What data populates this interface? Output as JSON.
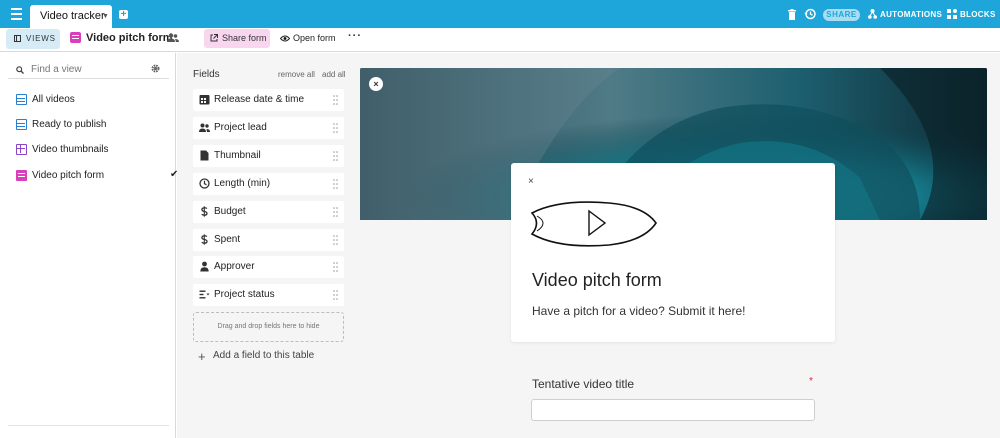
{
  "topbar": {
    "base_name": "Video tracker",
    "share_label": "SHARE",
    "automations_label": "AUTOMATIONS",
    "blocks_label": "BLOCKS",
    "bg_color": "#1ea6db"
  },
  "viewbar": {
    "views_label": "VIEWS",
    "current_view": "Video pitch form",
    "share_form_label": "Share form",
    "open_form_label": "Open form",
    "more_label": "···"
  },
  "sidebar": {
    "search_placeholder": "Find a view",
    "items": [
      {
        "label": "All videos",
        "icon": "grid-view-icon"
      },
      {
        "label": "Ready to publish",
        "icon": "grid-view-icon"
      },
      {
        "label": "Video thumbnails",
        "icon": "gallery-view-icon"
      },
      {
        "label": "Video pitch form",
        "icon": "form-view-icon",
        "selected": true
      }
    ]
  },
  "fields_panel": {
    "title": "Fields",
    "remove_all_label": "remove all",
    "add_all_label": "add all",
    "fields": [
      {
        "label": "Release date & time",
        "icon": "calendar-icon"
      },
      {
        "label": "Project lead",
        "icon": "collaborator-icon"
      },
      {
        "label": "Thumbnail",
        "icon": "attachment-icon"
      },
      {
        "label": "Length (min)",
        "icon": "duration-icon"
      },
      {
        "label": "Budget",
        "icon": "currency-icon"
      },
      {
        "label": "Spent",
        "icon": "currency-icon"
      },
      {
        "label": "Approver",
        "icon": "user-icon"
      },
      {
        "label": "Project status",
        "icon": "single-select-icon"
      }
    ],
    "drop_zone_label": "Drag and drop fields here to hide",
    "add_field_label": "Add a field to this table"
  },
  "form": {
    "title": "Video pitch form",
    "description": "Have a pitch for a video? Submit it here!",
    "close_label": "×",
    "remove_cover_label": "×",
    "questions": [
      {
        "label": "Tentative video title",
        "required_mark": "*",
        "value": ""
      }
    ]
  }
}
